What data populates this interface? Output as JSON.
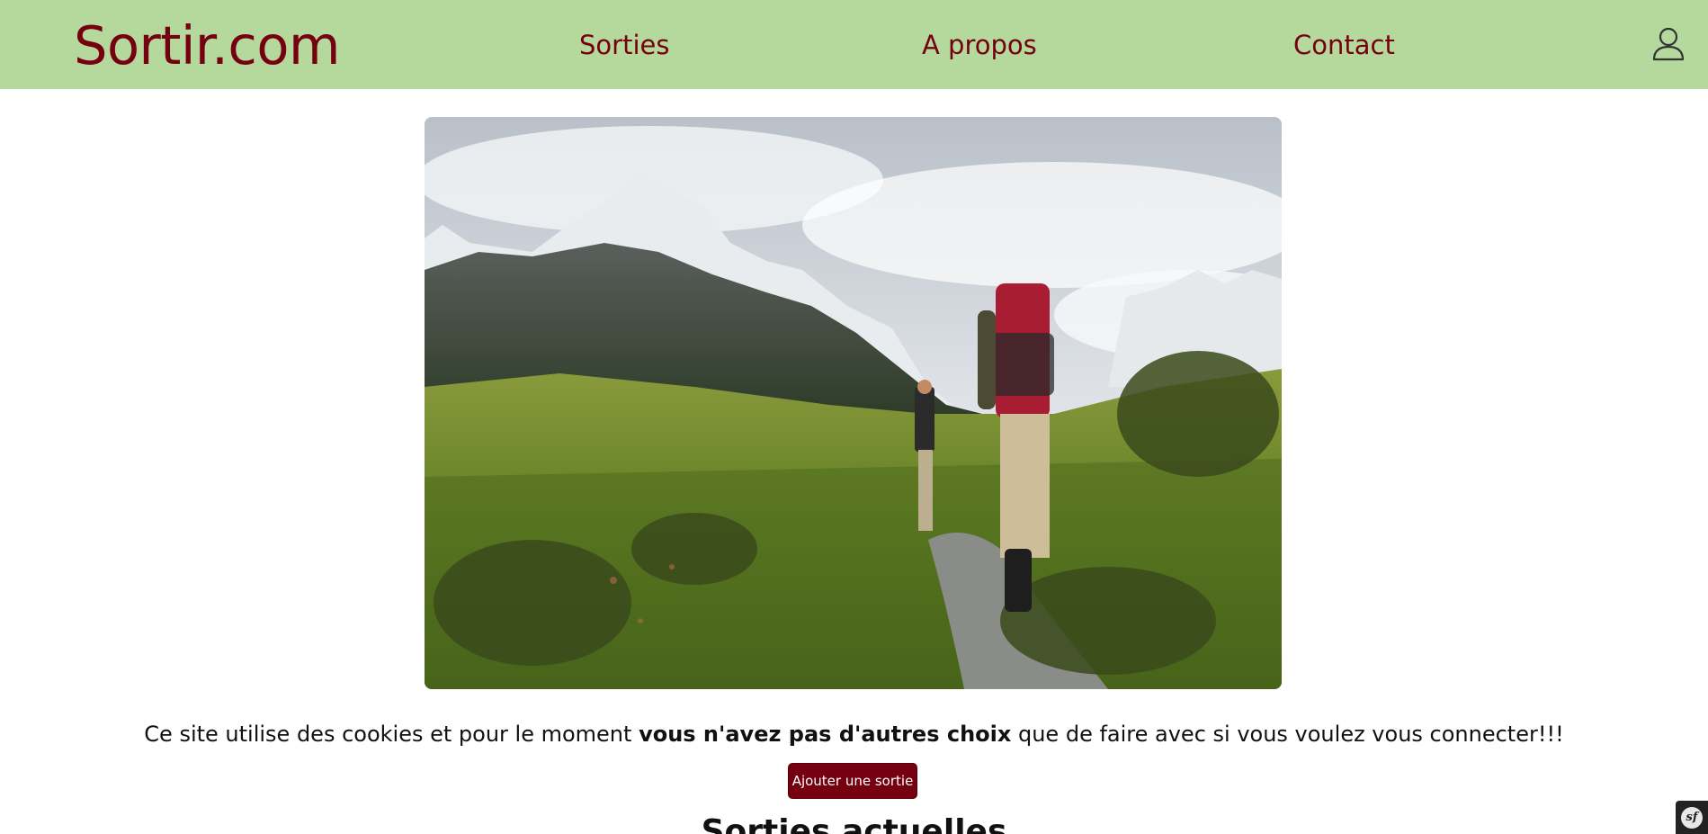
{
  "header": {
    "brand": "Sortir.com",
    "nav": {
      "sorties": "Sorties",
      "apropos": "A propos",
      "contact": "Contact"
    },
    "user_icon": "user-icon"
  },
  "hero": {
    "image": "hikers-mountain-photo"
  },
  "notice": {
    "before": "Ce site utilise des cookies et pour le moment ",
    "bold": "vous n'avez pas d'autres choix",
    "after": " que de faire avec si vous voulez vous connecter!!!"
  },
  "actions": {
    "add_label": "Ajouter une sortie"
  },
  "section": {
    "title": "Sorties actuelles"
  },
  "debug_toolbar": {
    "logo": "sf"
  },
  "colors": {
    "navbar_bg": "#b5d99c",
    "brand": "#75000f",
    "button_bg": "#75000f"
  }
}
